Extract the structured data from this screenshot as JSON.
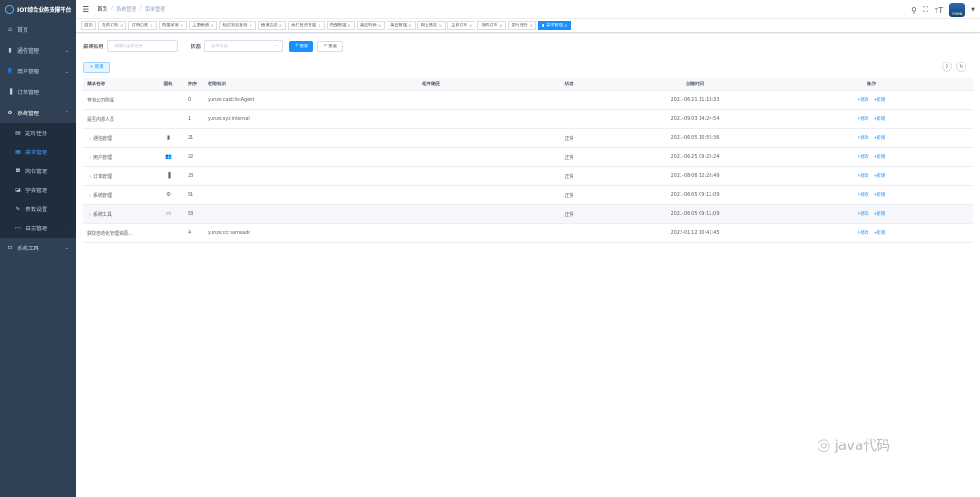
{
  "app": {
    "title": "IOT综合业务支撑平台"
  },
  "sidebar": {
    "items": [
      {
        "label": "首页",
        "icon": "home-icon"
      },
      {
        "label": "通信管理",
        "icon": "monitor-icon"
      },
      {
        "label": "用户管理",
        "icon": "users-icon"
      },
      {
        "label": "订单管理",
        "icon": "chart-icon"
      },
      {
        "label": "系统管理",
        "icon": "gear-icon"
      }
    ],
    "sub_items": [
      {
        "label": "定时任务"
      },
      {
        "label": "菜单管理"
      },
      {
        "label": "岗位管理"
      },
      {
        "label": "字典管理"
      },
      {
        "label": "参数设置"
      },
      {
        "label": "日志管理"
      }
    ],
    "tools_label": "系统工具"
  },
  "header": {
    "breadcrumb": [
      "首页",
      "系统管理",
      "菜单管理"
    ],
    "avatar_text": "云网智联"
  },
  "tags": [
    "首页",
    "资费订购",
    "订购历史",
    "用量详情",
    "上游通道",
    "短信消息查询",
    "通道信息",
    "执行任务管理",
    "内部管理",
    "集团列表",
    "集团管理",
    "岗位管理",
    "全部订单",
    "资费订单",
    "定时任务",
    "菜单管理"
  ],
  "search": {
    "name_label": "菜单名称",
    "name_placeholder": "请输入菜单名称",
    "status_label": "状态",
    "status_placeholder": "菜单状态",
    "search_btn": "搜索",
    "reset_btn": "重置"
  },
  "toolbar": {
    "add_label": "新增"
  },
  "table": {
    "headers": [
      "菜单名称",
      "图标",
      "排序",
      "权限标识",
      "组件路径",
      "状态",
      "创建时间",
      "操作"
    ],
    "op_edit": "修改",
    "op_add": "新增",
    "rows": [
      {
        "name": "查询公司所属",
        "expand": "",
        "icon": "",
        "order": "0",
        "perm": "yunze:card:listAgent",
        "status": "",
        "created": "2021-06-21 11:18:33"
      },
      {
        "name": "是否内部人员",
        "expand": "",
        "icon": "",
        "order": "1",
        "perm": "yunze:sys:internal",
        "status": "",
        "created": "2021-09-03 14:24:54"
      },
      {
        "name": "通信管理",
        "expand": "›",
        "icon": "▮",
        "order": "21",
        "perm": "",
        "status": "正常",
        "created": "2021-06-05 10:59:36"
      },
      {
        "name": "用户管理",
        "expand": "›",
        "icon": "👥",
        "order": "22",
        "perm": "",
        "status": "正常",
        "created": "2021-06-25 09:29:24"
      },
      {
        "name": "订单管理",
        "expand": "›",
        "icon": "▐",
        "order": "23",
        "perm": "",
        "status": "正常",
        "created": "2021-08-06 12:28:49"
      },
      {
        "name": "系统管理",
        "expand": "›",
        "icon": "⚙",
        "order": "51",
        "perm": "",
        "status": "正常",
        "created": "2021-06-05 09:12:09"
      },
      {
        "name": "系统工具",
        "expand": "›",
        "icon": "▭",
        "order": "53",
        "perm": "",
        "status": "正常",
        "created": "2021-06-05 09:12:09"
      },
      {
        "name": "获取自动化管理资源...",
        "expand": "",
        "icon": "",
        "order": "4",
        "perm": "yunze:cc:nameadd",
        "status": "",
        "created": "2022-01-12 10:41:45"
      }
    ]
  },
  "watermark": {
    "text": "java代码"
  }
}
